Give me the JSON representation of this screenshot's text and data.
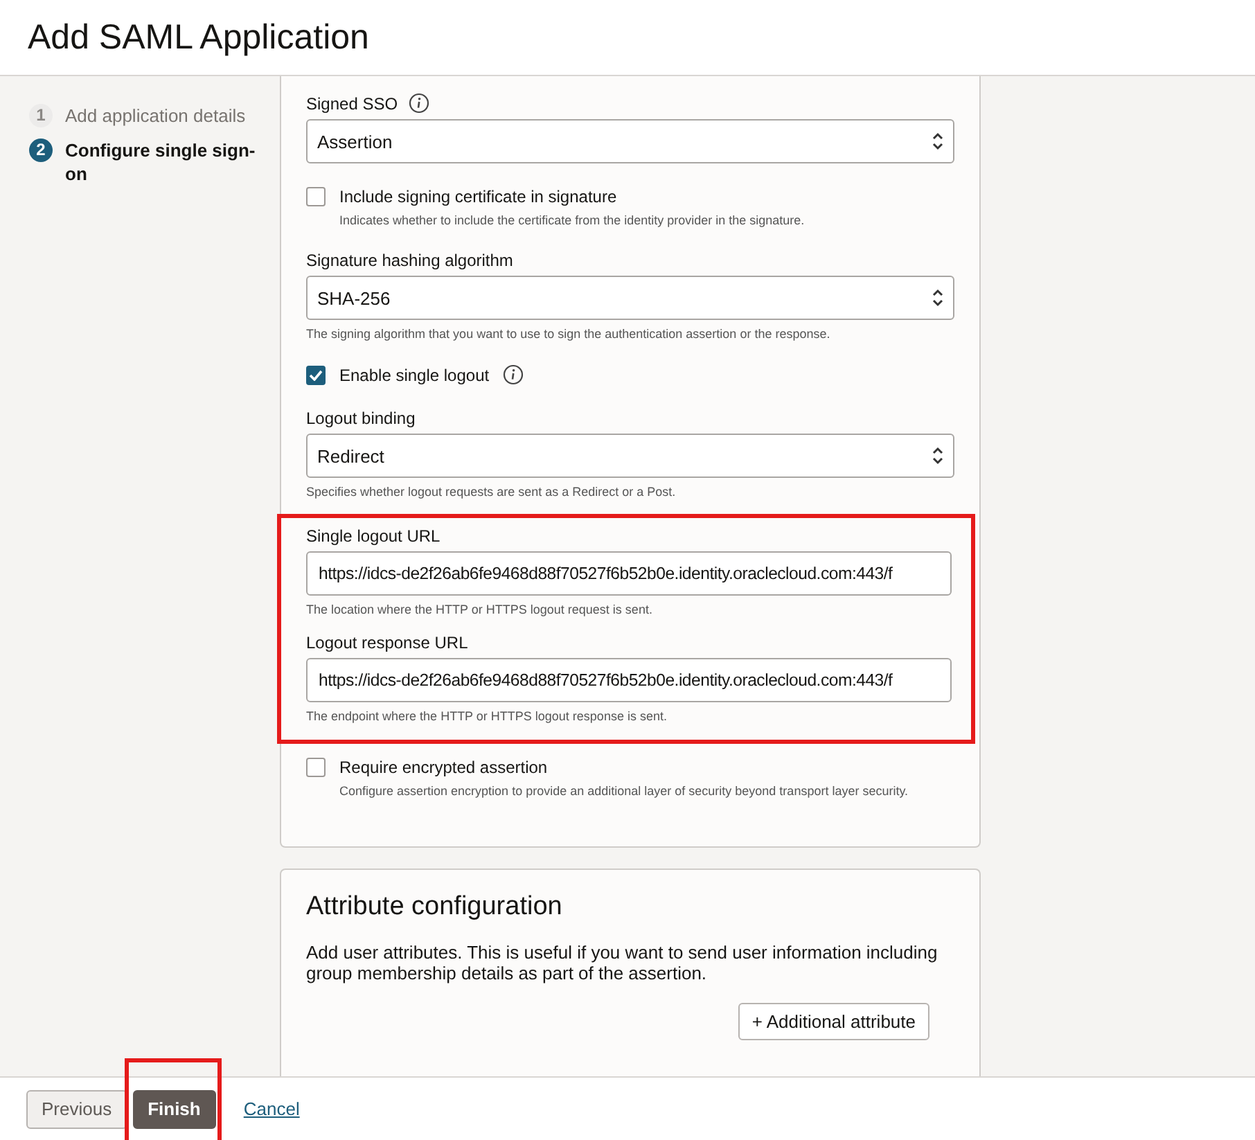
{
  "page_title": "Add SAML Application",
  "steps": [
    {
      "number": "1",
      "label": "Add application details",
      "selected": false
    },
    {
      "number": "2",
      "label": "Configure single sign-on",
      "selected": true
    }
  ],
  "form": {
    "items": [
      {
        "kind": "select",
        "label": "Signed SSO",
        "info": true,
        "value": "Assertion"
      },
      {
        "kind": "checkbox",
        "label": "Include signing certificate in signature",
        "checked": false,
        "help": "Indicates whether to include the certificate from the identity provider in the signature."
      },
      {
        "kind": "select",
        "label": "Signature hashing algorithm",
        "value": "SHA-256",
        "help": "The signing algorithm that you want to use to sign the authentication assertion or the response."
      },
      {
        "kind": "checkbox",
        "label": "Enable single logout",
        "info": true,
        "checked": true
      },
      {
        "kind": "select",
        "label": "Logout binding",
        "value": "Redirect",
        "help": "Specifies whether logout requests are sent as a Redirect or a Post."
      },
      {
        "kind": "group",
        "highlighted": true,
        "children": [
          {
            "kind": "text",
            "label": "Single logout URL",
            "value": "https://idcs-de2f26ab6fe9468d88f70527f6b52b0e.identity.oraclecloud.com:443/f",
            "help": "The location where the HTTP or HTTPS logout request is sent."
          },
          {
            "kind": "text",
            "label": "Logout response URL",
            "value": "https://idcs-de2f26ab6fe9468d88f70527f6b52b0e.identity.oraclecloud.com:443/f",
            "help": "The endpoint where the HTTP or HTTPS logout response is sent."
          }
        ]
      },
      {
        "kind": "checkbox",
        "label": "Require encrypted assertion",
        "checked": false,
        "help": "Configure assertion encryption to provide an additional layer of security beyond transport layer security."
      }
    ]
  },
  "attributes": {
    "title": "Attribute configuration",
    "description": "Add user attributes. This is useful if you want to send user information including group membership details as part of the assertion.",
    "button": "+ Additional attribute"
  },
  "footer": {
    "buttons": [
      {
        "kind": "secondary",
        "label": "Previous"
      },
      {
        "kind": "primary",
        "label": "Finish",
        "highlighted": true
      },
      {
        "kind": "link",
        "label": "Cancel"
      }
    ]
  }
}
